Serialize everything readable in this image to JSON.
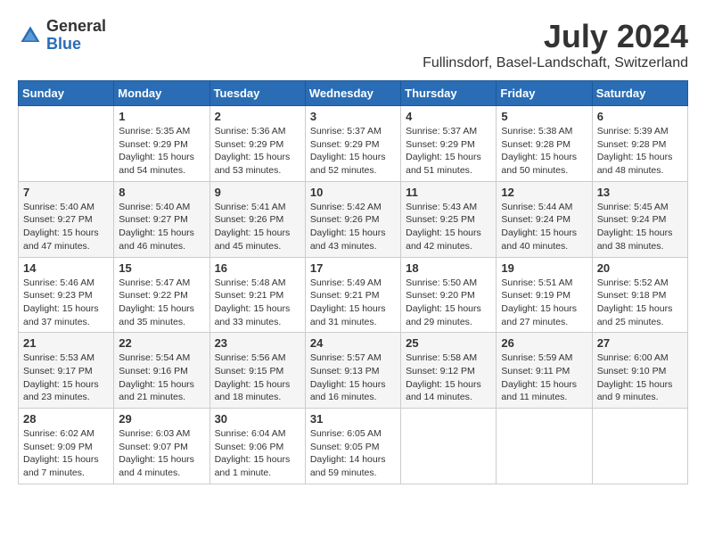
{
  "logo": {
    "general": "General",
    "blue": "Blue"
  },
  "title": {
    "month_year": "July 2024",
    "location": "Fullinsdorf, Basel-Landschaft, Switzerland"
  },
  "weekdays": [
    "Sunday",
    "Monday",
    "Tuesday",
    "Wednesday",
    "Thursday",
    "Friday",
    "Saturday"
  ],
  "weeks": [
    [
      {
        "day": "",
        "info": ""
      },
      {
        "day": "1",
        "info": "Sunrise: 5:35 AM\nSunset: 9:29 PM\nDaylight: 15 hours\nand 54 minutes."
      },
      {
        "day": "2",
        "info": "Sunrise: 5:36 AM\nSunset: 9:29 PM\nDaylight: 15 hours\nand 53 minutes."
      },
      {
        "day": "3",
        "info": "Sunrise: 5:37 AM\nSunset: 9:29 PM\nDaylight: 15 hours\nand 52 minutes."
      },
      {
        "day": "4",
        "info": "Sunrise: 5:37 AM\nSunset: 9:29 PM\nDaylight: 15 hours\nand 51 minutes."
      },
      {
        "day": "5",
        "info": "Sunrise: 5:38 AM\nSunset: 9:28 PM\nDaylight: 15 hours\nand 50 minutes."
      },
      {
        "day": "6",
        "info": "Sunrise: 5:39 AM\nSunset: 9:28 PM\nDaylight: 15 hours\nand 48 minutes."
      }
    ],
    [
      {
        "day": "7",
        "info": "Sunrise: 5:40 AM\nSunset: 9:27 PM\nDaylight: 15 hours\nand 47 minutes."
      },
      {
        "day": "8",
        "info": "Sunrise: 5:40 AM\nSunset: 9:27 PM\nDaylight: 15 hours\nand 46 minutes."
      },
      {
        "day": "9",
        "info": "Sunrise: 5:41 AM\nSunset: 9:26 PM\nDaylight: 15 hours\nand 45 minutes."
      },
      {
        "day": "10",
        "info": "Sunrise: 5:42 AM\nSunset: 9:26 PM\nDaylight: 15 hours\nand 43 minutes."
      },
      {
        "day": "11",
        "info": "Sunrise: 5:43 AM\nSunset: 9:25 PM\nDaylight: 15 hours\nand 42 minutes."
      },
      {
        "day": "12",
        "info": "Sunrise: 5:44 AM\nSunset: 9:24 PM\nDaylight: 15 hours\nand 40 minutes."
      },
      {
        "day": "13",
        "info": "Sunrise: 5:45 AM\nSunset: 9:24 PM\nDaylight: 15 hours\nand 38 minutes."
      }
    ],
    [
      {
        "day": "14",
        "info": "Sunrise: 5:46 AM\nSunset: 9:23 PM\nDaylight: 15 hours\nand 37 minutes."
      },
      {
        "day": "15",
        "info": "Sunrise: 5:47 AM\nSunset: 9:22 PM\nDaylight: 15 hours\nand 35 minutes."
      },
      {
        "day": "16",
        "info": "Sunrise: 5:48 AM\nSunset: 9:21 PM\nDaylight: 15 hours\nand 33 minutes."
      },
      {
        "day": "17",
        "info": "Sunrise: 5:49 AM\nSunset: 9:21 PM\nDaylight: 15 hours\nand 31 minutes."
      },
      {
        "day": "18",
        "info": "Sunrise: 5:50 AM\nSunset: 9:20 PM\nDaylight: 15 hours\nand 29 minutes."
      },
      {
        "day": "19",
        "info": "Sunrise: 5:51 AM\nSunset: 9:19 PM\nDaylight: 15 hours\nand 27 minutes."
      },
      {
        "day": "20",
        "info": "Sunrise: 5:52 AM\nSunset: 9:18 PM\nDaylight: 15 hours\nand 25 minutes."
      }
    ],
    [
      {
        "day": "21",
        "info": "Sunrise: 5:53 AM\nSunset: 9:17 PM\nDaylight: 15 hours\nand 23 minutes."
      },
      {
        "day": "22",
        "info": "Sunrise: 5:54 AM\nSunset: 9:16 PM\nDaylight: 15 hours\nand 21 minutes."
      },
      {
        "day": "23",
        "info": "Sunrise: 5:56 AM\nSunset: 9:15 PM\nDaylight: 15 hours\nand 18 minutes."
      },
      {
        "day": "24",
        "info": "Sunrise: 5:57 AM\nSunset: 9:13 PM\nDaylight: 15 hours\nand 16 minutes."
      },
      {
        "day": "25",
        "info": "Sunrise: 5:58 AM\nSunset: 9:12 PM\nDaylight: 15 hours\nand 14 minutes."
      },
      {
        "day": "26",
        "info": "Sunrise: 5:59 AM\nSunset: 9:11 PM\nDaylight: 15 hours\nand 11 minutes."
      },
      {
        "day": "27",
        "info": "Sunrise: 6:00 AM\nSunset: 9:10 PM\nDaylight: 15 hours\nand 9 minutes."
      }
    ],
    [
      {
        "day": "28",
        "info": "Sunrise: 6:02 AM\nSunset: 9:09 PM\nDaylight: 15 hours\nand 7 minutes."
      },
      {
        "day": "29",
        "info": "Sunrise: 6:03 AM\nSunset: 9:07 PM\nDaylight: 15 hours\nand 4 minutes."
      },
      {
        "day": "30",
        "info": "Sunrise: 6:04 AM\nSunset: 9:06 PM\nDaylight: 15 hours\nand 1 minute."
      },
      {
        "day": "31",
        "info": "Sunrise: 6:05 AM\nSunset: 9:05 PM\nDaylight: 14 hours\nand 59 minutes."
      },
      {
        "day": "",
        "info": ""
      },
      {
        "day": "",
        "info": ""
      },
      {
        "day": "",
        "info": ""
      }
    ]
  ]
}
